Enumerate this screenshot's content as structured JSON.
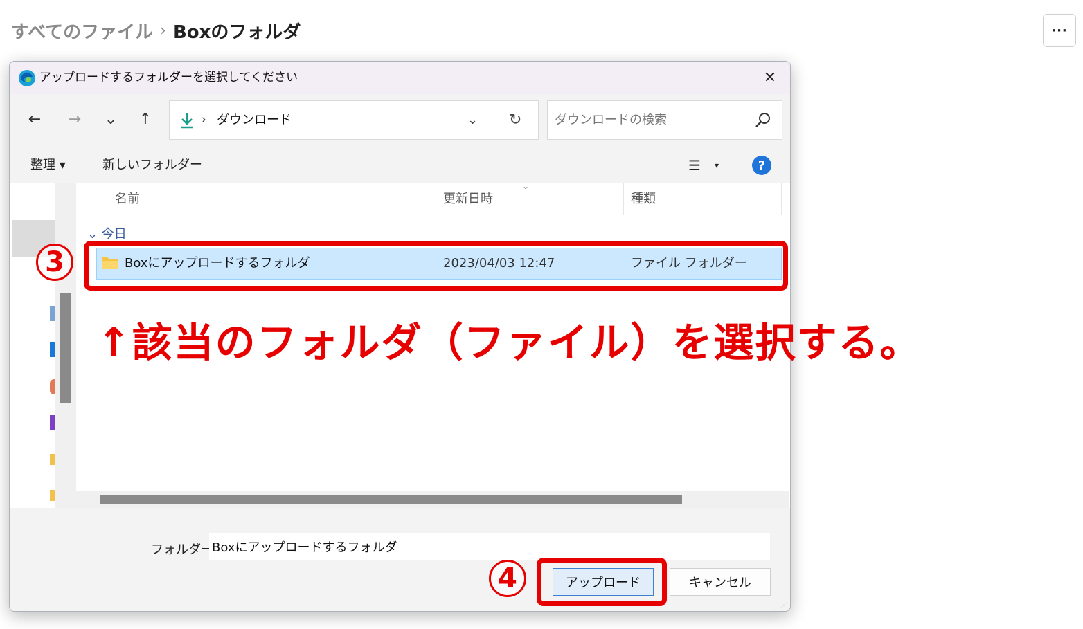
{
  "box": {
    "breadcrumb_parent": "すべてのファイル",
    "breadcrumb_sep": "›",
    "breadcrumb_current": "Boxのフォルダ",
    "more_label": "···"
  },
  "dialog": {
    "title": "アップロードするフォルダーを選択してください",
    "close": "✕",
    "nav": {
      "back": "←",
      "forward": "→",
      "recent": "⌄",
      "up": "↑"
    },
    "address": {
      "sep": "›",
      "path": "ダウンロード",
      "dropdown": "⌄",
      "refresh": "↻"
    },
    "search": {
      "placeholder": "ダウンロードの検索"
    },
    "toolbar": {
      "organize": "整理 ▾",
      "new_folder": "新しいフォルダー",
      "view": "☰",
      "view_dd": "▾",
      "help": "?"
    },
    "columns": {
      "name": "名前",
      "modified": "更新日時",
      "type": "種類"
    },
    "group": "⌄ 今日",
    "files": [
      {
        "name": "Boxにアップロードするフォルダ",
        "modified": "2023/04/03 12:47",
        "type": "ファイル フォルダー"
      }
    ],
    "folder_label": "フォルダー:",
    "folder_value": "Boxにアップロードするフォルダ",
    "upload_button": "アップロード",
    "cancel_button": "キャンセル"
  },
  "annotation": {
    "step3": "3",
    "step4": "4",
    "instruction": "↑該当のフォルダ（ファイル）を選択する。",
    "color": "#e60000"
  }
}
